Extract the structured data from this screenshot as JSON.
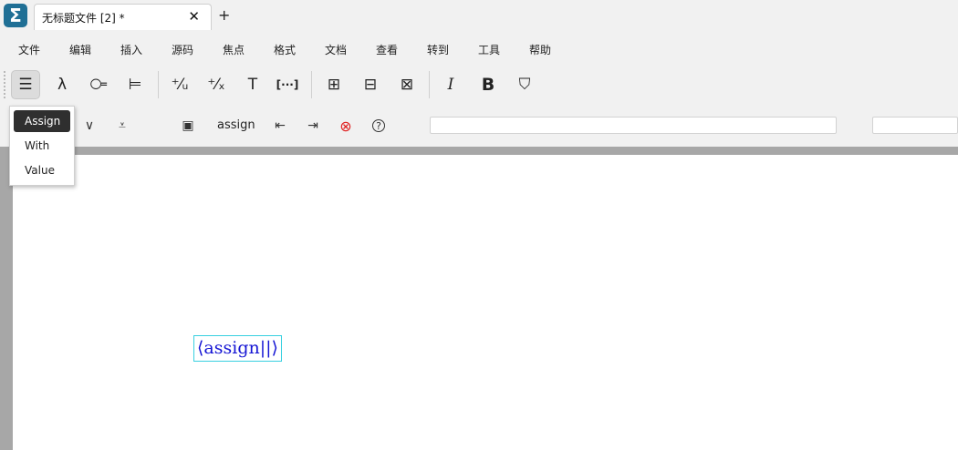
{
  "app": {
    "icon_glyph": "Σ"
  },
  "tab": {
    "title": "无标题文件 [2] *",
    "close": "✕",
    "add": "+"
  },
  "menu": [
    "文件",
    "编辑",
    "插入",
    "源码",
    "焦点",
    "格式",
    "文档",
    "查看",
    "转到",
    "工具",
    "帮助"
  ],
  "toolbar": {
    "buttons": [
      {
        "icon": "list-icon",
        "glyph": "☰"
      },
      {
        "icon": "lambda-icon",
        "glyph": "λ"
      },
      {
        "icon": "droplet-icon",
        "glyph": "⧃"
      },
      {
        "icon": "tree-icon",
        "glyph": "⊨"
      },
      {
        "icon": "plus-z-icon",
        "glyph": "⁺⁄ᵤ"
      },
      {
        "icon": "percent-x-icon",
        "glyph": "⁺⁄ₓ"
      },
      {
        "icon": "text-icon",
        "glyph": "T"
      },
      {
        "icon": "dots-bracket-icon",
        "glyph": "[···]"
      },
      {
        "icon": "fold-icon-1",
        "glyph": "⊞"
      },
      {
        "icon": "fold-icon-2",
        "glyph": "⊟"
      },
      {
        "icon": "fold-icon-3",
        "glyph": "⊠"
      },
      {
        "icon": "italic-icon",
        "glyph": "I"
      },
      {
        "icon": "bold-icon",
        "glyph": "B"
      },
      {
        "icon": "fill-icon",
        "glyph": "⛉"
      }
    ]
  },
  "focusbar": {
    "label": "assign",
    "icons": [
      {
        "name": "chevron-down-icon",
        "glyph": "∨"
      },
      {
        "name": "chevron-down-bar-icon",
        "glyph": "⩡"
      },
      {
        "name": "doc-icon",
        "glyph": "▣"
      },
      {
        "name": "arrow-left-box-icon",
        "glyph": "⇤"
      },
      {
        "name": "arrow-right-box-icon",
        "glyph": "⇥"
      },
      {
        "name": "error-icon",
        "glyph": "⊗"
      },
      {
        "name": "help-icon",
        "glyph": "?"
      }
    ]
  },
  "dropdown": {
    "items": [
      "Assign",
      "With",
      "Value"
    ],
    "selected": "Assign"
  },
  "document": {
    "macro_text": "⟨assign||⟩"
  }
}
